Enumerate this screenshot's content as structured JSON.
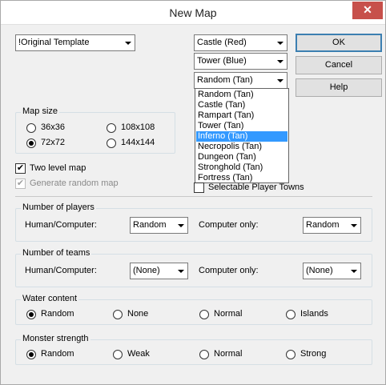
{
  "window": {
    "title": "New Map",
    "close_glyph": "✕"
  },
  "template": {
    "selected": "!Original Template"
  },
  "players": [
    {
      "selected": "Castle (Red)"
    },
    {
      "selected": "Tower (Blue)"
    },
    {
      "selected": "Random (Tan)"
    }
  ],
  "town_dropdown": {
    "options": [
      "Random (Tan)",
      "Castle (Tan)",
      "Rampart (Tan)",
      "Tower (Tan)",
      "Inferno (Tan)",
      "Necropolis (Tan)",
      "Dungeon (Tan)",
      "Stronghold (Tan)",
      "Fortress (Tan)"
    ],
    "highlighted": "Inferno (Tan)"
  },
  "buttons": {
    "ok": "OK",
    "cancel": "Cancel",
    "help": "Help"
  },
  "map_size": {
    "legend": "Map size",
    "options": [
      "36x36",
      "108x108",
      "72x72",
      "144x144"
    ],
    "selected": "72x72"
  },
  "two_level": {
    "label": "Two level map",
    "checked": true
  },
  "generate_random": {
    "label": "Generate random map",
    "checked": true,
    "disabled": true
  },
  "selectable_towns": {
    "label": "Selectable Player Towns",
    "checked": false
  },
  "number_of_players": {
    "legend": "Number of players",
    "human_label": "Human/Computer:",
    "human_value": "Random",
    "computer_label": "Computer only:",
    "computer_value": "Random"
  },
  "number_of_teams": {
    "legend": "Number of teams",
    "human_label": "Human/Computer:",
    "human_value": "(None)",
    "computer_label": "Computer only:",
    "computer_value": "(None)"
  },
  "water_content": {
    "legend": "Water content",
    "options": [
      "Random",
      "None",
      "Normal",
      "Islands"
    ],
    "selected": "Random"
  },
  "monster_strength": {
    "legend": "Monster strength",
    "options": [
      "Random",
      "Weak",
      "Normal",
      "Strong"
    ],
    "selected": "Random"
  },
  "icons": {
    "checkmark": "✔"
  }
}
